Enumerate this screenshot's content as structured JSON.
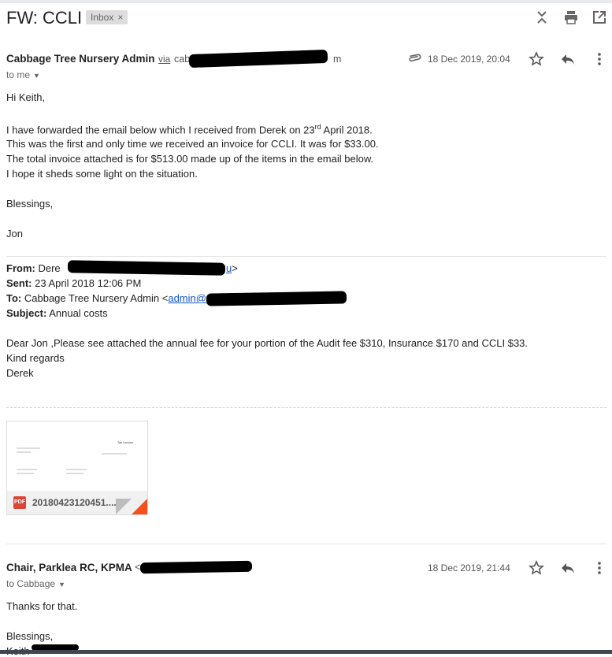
{
  "thread": {
    "subject": "FW: CCLI",
    "label_chip": "Inbox",
    "label_close": "×"
  },
  "msg1": {
    "sender": "Cabbage Tree Nursery Admin",
    "via": "via",
    "email_start": "cab",
    "email_end": "m",
    "date": "18 Dec 2019, 20:04",
    "to": "to me",
    "greeting": "Hi Keith,",
    "line1a": "I have forwarded the email below which I received from Derek on 23",
    "line1sup": "rd",
    "line1b": " April 2018.",
    "line2": "This was the first and only time we received an invoice for CCLI. It was for $33.00.",
    "line3": "The total invoice attached is for $513.00 made up of the items in the email below.",
    "line4": "I hope it sheds some light on the situation.",
    "closing": "Blessings,",
    "signature": "Jon"
  },
  "forwarded": {
    "from_label": "From:",
    "from_value": "Dere",
    "from_email_tail": "u",
    "sent_label": "Sent:",
    "sent_value": "23 April 2018 12:06 PM",
    "to_label": "To:",
    "to_value": "Cabbage Tree Nursery Admin <",
    "to_email": "admin@",
    "subject_label": "Subject:",
    "subject_value": "Annual costs",
    "body1": "Dear Jon ,Please see attached the annual fee for your portion of the Audit fee $310, Insurance $170 and CCLI $33.",
    "body2": "Kind regards",
    "body3": "Derek"
  },
  "attachment": {
    "badge": "PDF",
    "filename": "20180423120451....",
    "preview_title": "Tax Invoice"
  },
  "msg2": {
    "sender": "Chair, Parklea RC, KPMA",
    "email_start": "<",
    "date": "18 Dec 2019, 21:44",
    "to": "to Cabbage",
    "line1": "Thanks for that.",
    "closing": "Blessings,",
    "signature": "Keith"
  },
  "icons": [
    "expand-collapse-icon",
    "print-icon",
    "open-in-new-window-icon",
    "paperclip-icon",
    "star-icon",
    "reply-icon",
    "more-icon",
    "caret-down-icon"
  ]
}
